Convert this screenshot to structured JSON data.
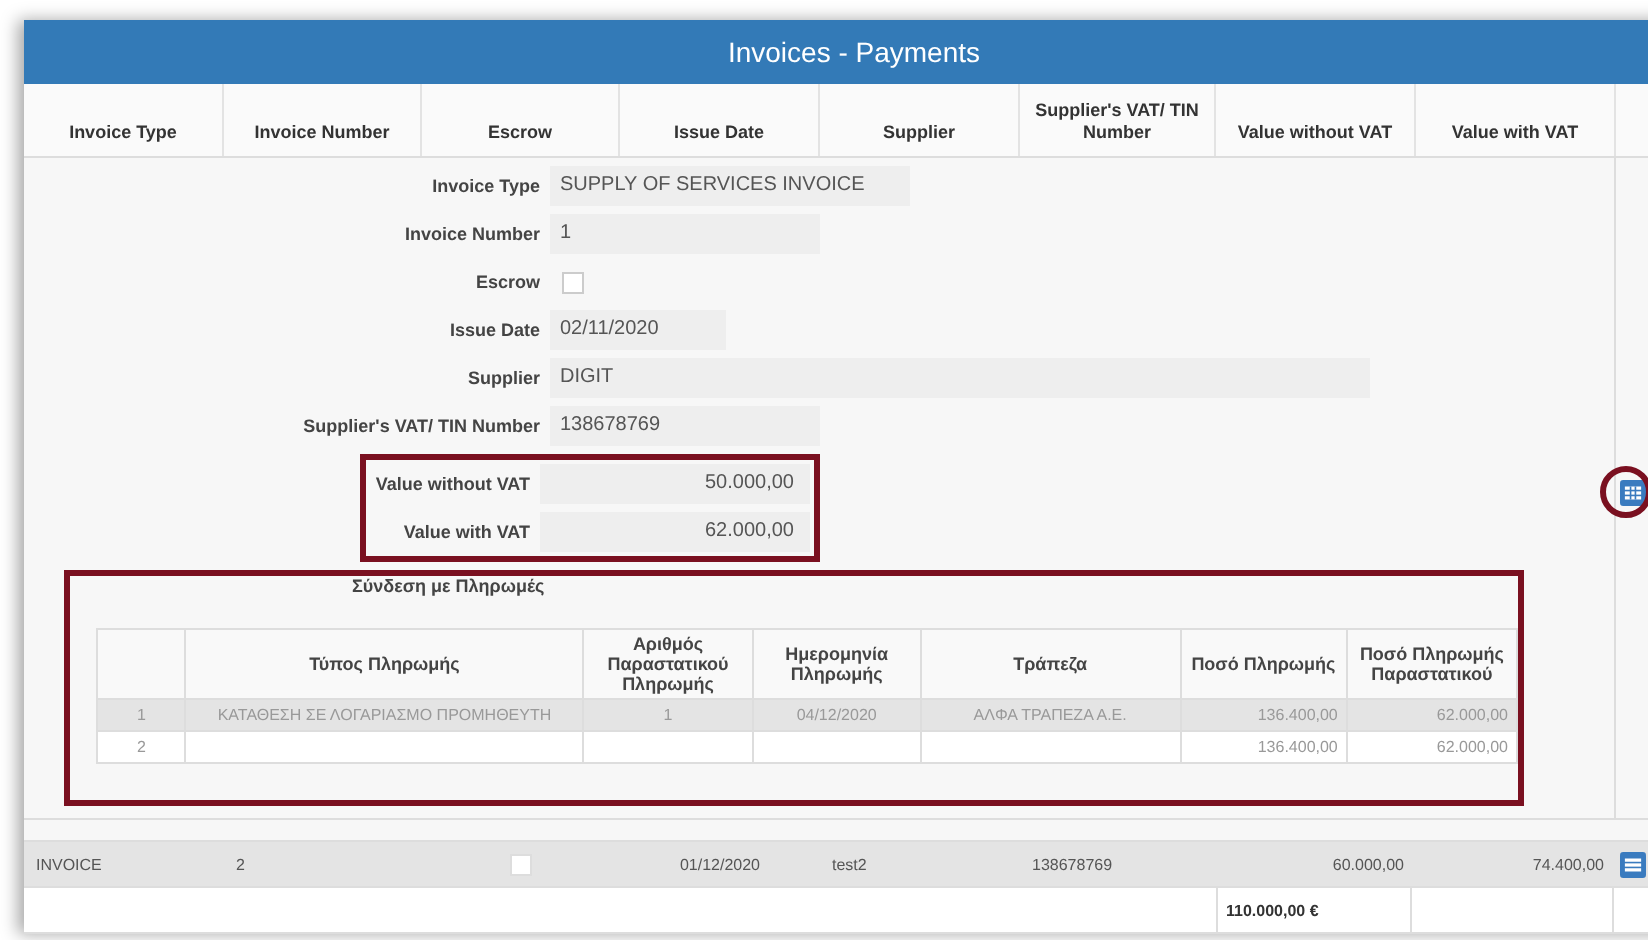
{
  "window": {
    "title": "Invoices - Payments"
  },
  "columns": [
    "Invoice Type",
    "Invoice Number",
    "Escrow",
    "Issue Date",
    "Supplier",
    "Supplier's VAT/ TIN Number",
    "Value without VAT",
    "Value with VAT"
  ],
  "details": {
    "fields": [
      {
        "kind": "text",
        "label": "Invoice Type",
        "value": "SUPPLY OF SERVICES INVOICE"
      },
      {
        "kind": "text",
        "label": "Invoice Number",
        "value": "1"
      },
      {
        "kind": "checkbox",
        "label": "Escrow",
        "checked": false
      },
      {
        "kind": "text",
        "label": "Issue Date",
        "value": "02/11/2020"
      },
      {
        "kind": "text",
        "label": "Supplier",
        "value": "DIGIT"
      },
      {
        "kind": "text",
        "label": "Supplier's VAT/ TIN Number",
        "value": "138678769"
      }
    ],
    "highlighted_fields": [
      {
        "kind": "amount",
        "label": "Value without VAT",
        "value": "50.000,00"
      },
      {
        "kind": "amount",
        "label": "Value with VAT",
        "value": "62.000,00"
      }
    ],
    "payments": {
      "title": "Σύνδεση με Πληρωμές",
      "columns": [
        "",
        "Τύπος Πληρωμής",
        "Αριθμός Παραστατικού Πληρωμής",
        "Ημερομηνία Πληρωμής",
        "Τράπεζα",
        "Ποσό Πληρωμής",
        "Ποσό Πληρωμής Παραστατικού"
      ],
      "rows": [
        {
          "selected": true,
          "cells": [
            "1",
            "ΚΑΤΑΘΕΣΗ ΣΕ ΛΟΓΑΡΙΑΣΜΟ ΠΡΟΜΗΘΕΥΤΗ",
            "1",
            "04/12/2020",
            "ΑΛΦΑ ΤΡΑΠΕΖΑ Α.Ε.",
            "136.400,00",
            "62.000,00"
          ]
        },
        {
          "selected": false,
          "cells": [
            "2",
            "",
            "",
            "",
            "",
            "136.400,00",
            "62.000,00"
          ]
        }
      ]
    }
  },
  "invoice_rows": [
    {
      "selected": true,
      "invoice_type": "INVOICE",
      "invoice_number": "2",
      "escrow": false,
      "issue_date": "01/12/2020",
      "supplier": "test2",
      "vat_number": "138678769",
      "value_without_vat": "60.000,00",
      "value_with_vat": "74.400,00"
    }
  ],
  "total": "110.000,00 €"
}
